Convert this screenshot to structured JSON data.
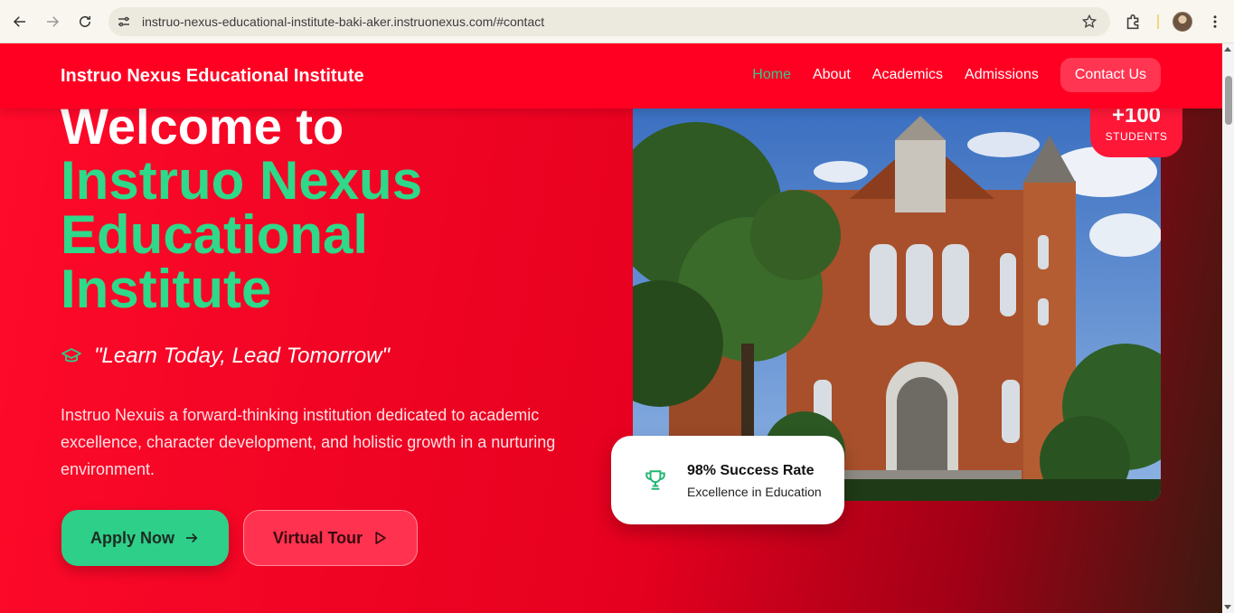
{
  "browser": {
    "url": "instruo-nexus-educational-institute-baki-aker.instruonexus.com/#contact"
  },
  "site": {
    "brand": "Instruo Nexus Educational Institute",
    "nav": {
      "home": "Home",
      "about": "About",
      "academics": "Academics",
      "admissions": "Admissions",
      "contact": "Contact Us"
    }
  },
  "hero": {
    "heading_line1": "Welcome to",
    "heading_name_1": "Instruo Nexus",
    "heading_name_2": "Educational",
    "heading_name_3": "Institute",
    "tagline": "\"Learn Today, Lead Tomorrow\"",
    "description": "Instruo Nexuis a forward-thinking institution dedicated to academic excellence, character development, and holistic growth in a nurturing environment.",
    "apply_label": "Apply Now",
    "tour_label": "Virtual Tour"
  },
  "stats": {
    "students_count": "+100",
    "students_label": "STUDENTS",
    "success_title": "98% Success Rate",
    "success_subtitle": "Excellence in Education"
  },
  "icons": {
    "tagline": "graduation-cap-icon",
    "success": "trophy-icon",
    "apply": "arrow-right-icon",
    "tour": "play-icon"
  },
  "colors": {
    "primary_red": "#ff0022",
    "accent_green": "#2ecf89",
    "header_active": "#35c98a"
  }
}
